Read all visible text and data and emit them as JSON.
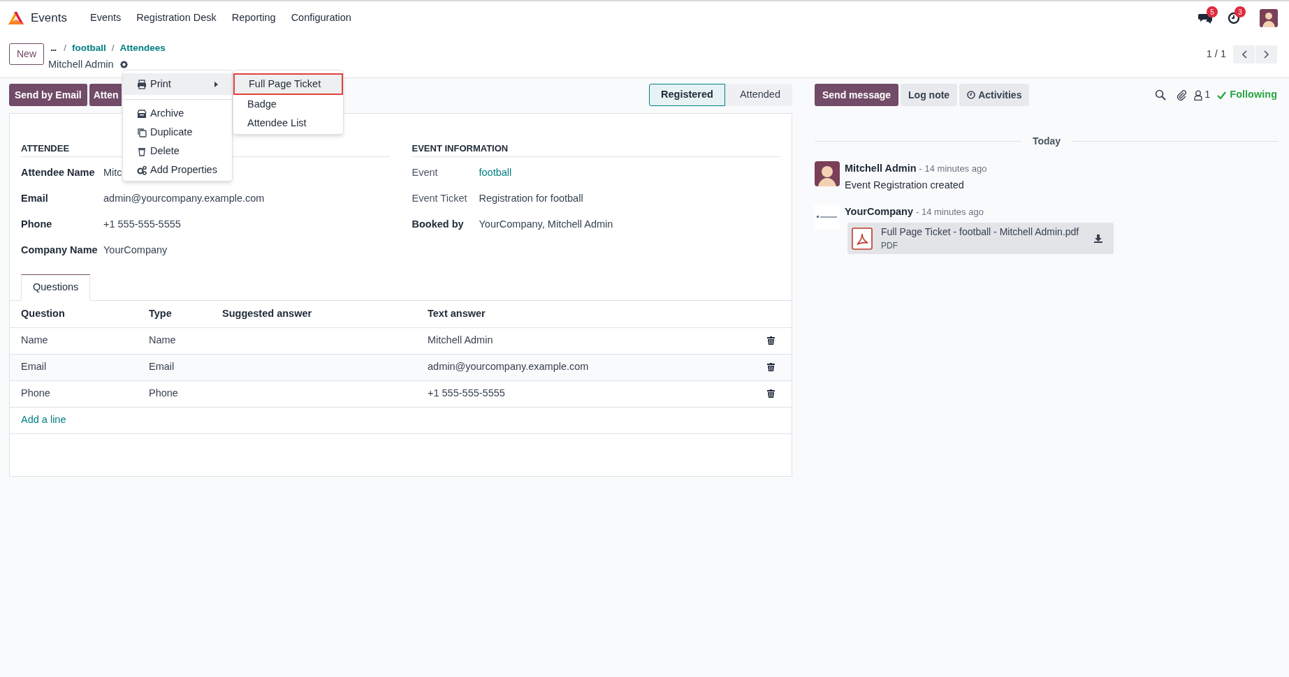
{
  "navbar": {
    "app_name": "Events",
    "menu": [
      "Events",
      "Registration Desk",
      "Reporting",
      "Configuration"
    ],
    "messages_count": "5",
    "activities_count": "3"
  },
  "breadcrumb": {
    "separator": "/",
    "items": [
      {
        "label": "...",
        "kind": "more"
      },
      {
        "label": "football",
        "kind": "link"
      },
      {
        "label": "Attendees",
        "kind": "link"
      }
    ],
    "record_title": "Mitchell Admin"
  },
  "new_button": "New",
  "pager": "1 / 1",
  "action_buttons": [
    "Send by Email",
    "Atten"
  ],
  "stages": [
    {
      "label": "Registered",
      "selected": true
    },
    {
      "label": "Attended",
      "selected": false
    }
  ],
  "gear_menu": {
    "items": [
      {
        "label": "Print",
        "kind": "submenu",
        "expanded": true
      },
      {
        "label": "Archive",
        "kind": "archive"
      },
      {
        "label": "Duplicate",
        "kind": "duplicate"
      },
      {
        "label": "Delete",
        "kind": "delete"
      },
      {
        "label": "Add Properties",
        "kind": "properties"
      }
    ],
    "submenu": [
      {
        "label": "Full Page Ticket",
        "selected": true
      },
      {
        "label": "Badge",
        "selected": false
      },
      {
        "label": "Attendee List",
        "selected": false
      }
    ]
  },
  "attendee": {
    "title": "ATTENDEE",
    "fields": [
      {
        "label": "Attendee Name",
        "value": "Mitc"
      },
      {
        "label": "Email",
        "value": "admin@yourcompany.example.com"
      },
      {
        "label": "Phone",
        "value": "+1 555-555-5555"
      },
      {
        "label": "Company Name",
        "value": "YourCompany"
      }
    ]
  },
  "event_information": {
    "title": "EVENT INFORMATION",
    "fields": [
      {
        "label": "Event",
        "value": "football",
        "readonly": true,
        "kind": "link"
      },
      {
        "label": "Event Ticket",
        "value": "Registration for football",
        "readonly": true,
        "kind": "text"
      },
      {
        "label": "Booked by",
        "value": "YourCompany, Mitchell Admin",
        "readonly": false,
        "kind": "text"
      }
    ]
  },
  "tabs": [
    {
      "label": "Questions",
      "selected": true
    }
  ],
  "table": {
    "columns": [
      "Question",
      "Type",
      "Suggested answer",
      "Text answer"
    ],
    "rows": [
      [
        "Name",
        "Name",
        "",
        "Mitchell Admin"
      ],
      [
        "Email",
        "Email",
        "",
        "admin@yourcompany.example.com"
      ],
      [
        "Phone",
        "Phone",
        "",
        "+1 555-555-5555"
      ]
    ],
    "add_line": "Add a line"
  },
  "chatter": {
    "buttons": [
      {
        "label": "Send message",
        "kind": "primary"
      },
      {
        "label": "Log note",
        "kind": "secondary"
      },
      {
        "label": "Activities",
        "kind": "activities"
      }
    ],
    "followers": "1",
    "following": "Following",
    "date_separator": "Today",
    "messages": [
      {
        "author": "Mitchell Admin",
        "kind": "user",
        "time": "- 14 minutes ago",
        "body": "Event Registration created"
      },
      {
        "author": "YourCompany",
        "kind": "company",
        "time": "- 14 minutes ago",
        "attachment": {
          "name": "Full Page Ticket - football - Mitchell Admin.pdf",
          "type": "PDF"
        }
      }
    ]
  }
}
